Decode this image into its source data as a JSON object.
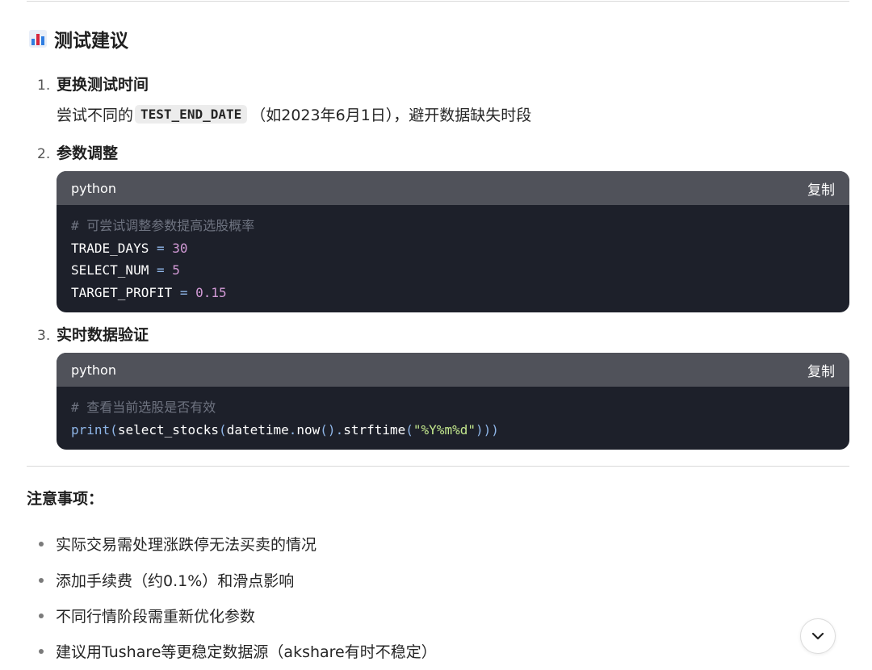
{
  "section": {
    "icon": "bar-chart-icon",
    "title": "测试建议"
  },
  "items": [
    {
      "number": "1.",
      "heading": "更换测试时间",
      "body_prefix": "尝试不同的",
      "inline_code": "TEST_END_DATE",
      "body_suffix": "（如2023年6月1日），避开数据缺失时段"
    },
    {
      "number": "2.",
      "heading": "参数调整"
    },
    {
      "number": "3.",
      "heading": "实时数据验证"
    }
  ],
  "code_blocks": [
    {
      "language": "python",
      "copy_label": "复制",
      "comment": "# 可尝试调整参数提高选股概率",
      "lines": [
        {
          "name": "TRADE_DAYS",
          "op": "=",
          "value": "30"
        },
        {
          "name": "SELECT_NUM",
          "op": "=",
          "value": "5"
        },
        {
          "name": "TARGET_PROFIT",
          "op": "=",
          "value": "0.15"
        }
      ]
    },
    {
      "language": "python",
      "copy_label": "复制",
      "comment": "# 查看当前选股是否有效",
      "tokens": {
        "print": "print",
        "p1": "(",
        "fn": "select_stocks",
        "p2": "(",
        "obj": "datetime",
        "dot1": ".",
        "now": "now",
        "p3": "()",
        "dot2": ".",
        "strftime": "strftime",
        "p4": "(",
        "str": "\"%Y%m%d\"",
        "p5": ")))"
      }
    }
  ],
  "notes": {
    "title": "注意事项：",
    "bullets": [
      "实际交易需处理涨跌停无法买卖的情况",
      "添加手续费（约0.1%）和滑点影响",
      "不同行情阶段需重新优化参数",
      "建议用Tushare等更稳定数据源（akshare有时不稳定）"
    ]
  },
  "scroll_button": {
    "icon": "chevron-down-icon"
  },
  "colors": {
    "code_bg": "#1d202a",
    "code_header": "#50525a",
    "comment": "#6e7380",
    "number": "#d29ad6",
    "string": "#c3e88d"
  }
}
